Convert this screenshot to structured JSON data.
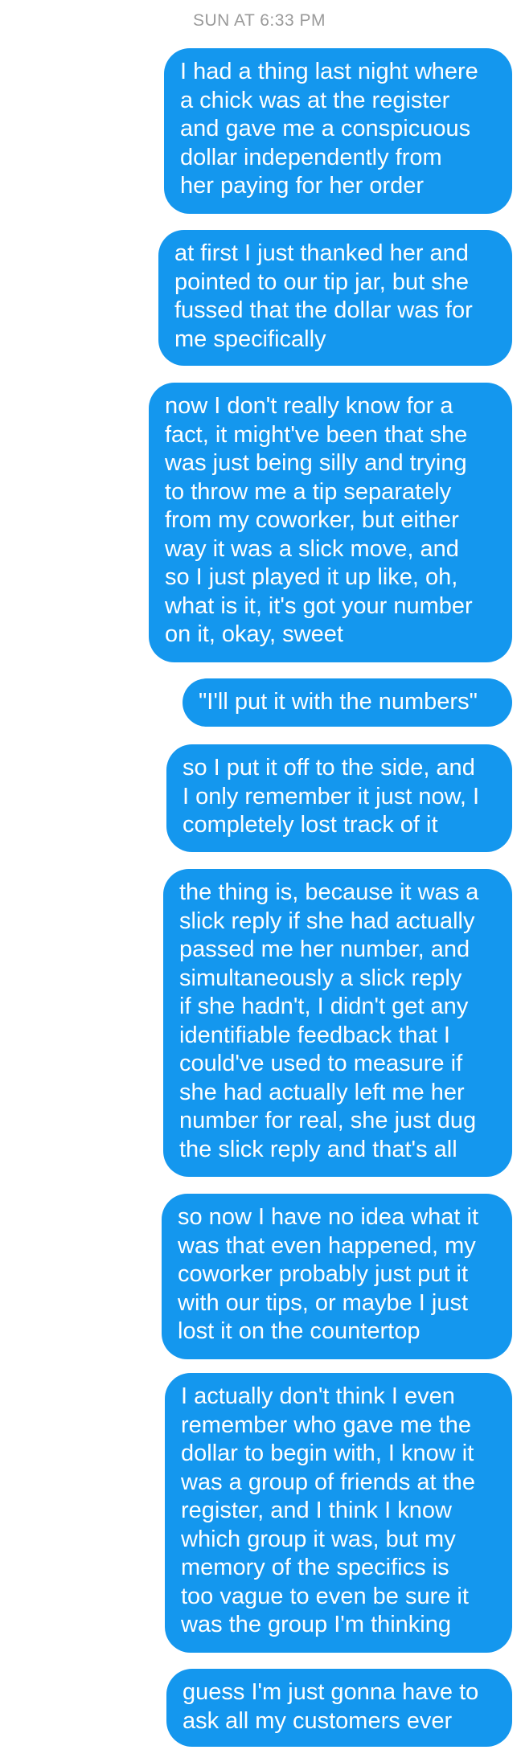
{
  "conversation": {
    "timestamp": "SUN AT 6:33 PM",
    "accent_color": "#1497ee",
    "messages": [
      {
        "sender": "me",
        "text": "I had a thing last night where\na chick was at the register\nand gave me a conspicuous\ndollar independently from\nher paying for her order"
      },
      {
        "sender": "me",
        "text": "at first I just thanked her and\npointed to our tip jar, but she\nfussed that the dollar was for\nme specifically"
      },
      {
        "sender": "me",
        "text": "now I don't really know for a\nfact, it might've been that she\nwas just being silly and trying\nto throw me a tip separately\nfrom my coworker, but either\nway it was a slick move, and\nso I just played it up like, oh,\nwhat is it, it's got your number\non it, okay, sweet"
      },
      {
        "sender": "me",
        "text": "\"I'll put it with the numbers\""
      },
      {
        "sender": "me",
        "text": "so I put it off to the side, and\nI only remember it just now, I\ncompletely lost track of it"
      },
      {
        "sender": "me",
        "text": "the thing is, because it was a\nslick reply if she had actually\npassed me her number, and\nsimultaneously a slick reply\nif she hadn't, I didn't get any\nidentifiable feedback that I\ncould've used to measure if\nshe had actually left me her\nnumber for real, she just dug\nthe slick reply and that's all"
      },
      {
        "sender": "me",
        "text": "so now I have no idea what it\nwas that even happened, my\ncoworker probably just put it\nwith our tips, or maybe I just\nlost it on the countertop"
      },
      {
        "sender": "me",
        "text": "I actually don't think I even\nremember who gave me the\ndollar to begin with, I know it\nwas a group of friends at the\nregister, and I think I know\nwhich group it was, but my\nmemory of the specifics is\ntoo vague to even be sure it\nwas the group I'm thinking"
      },
      {
        "sender": "me",
        "text": "guess I'm just gonna have to\nask all my customers ever"
      }
    ]
  }
}
